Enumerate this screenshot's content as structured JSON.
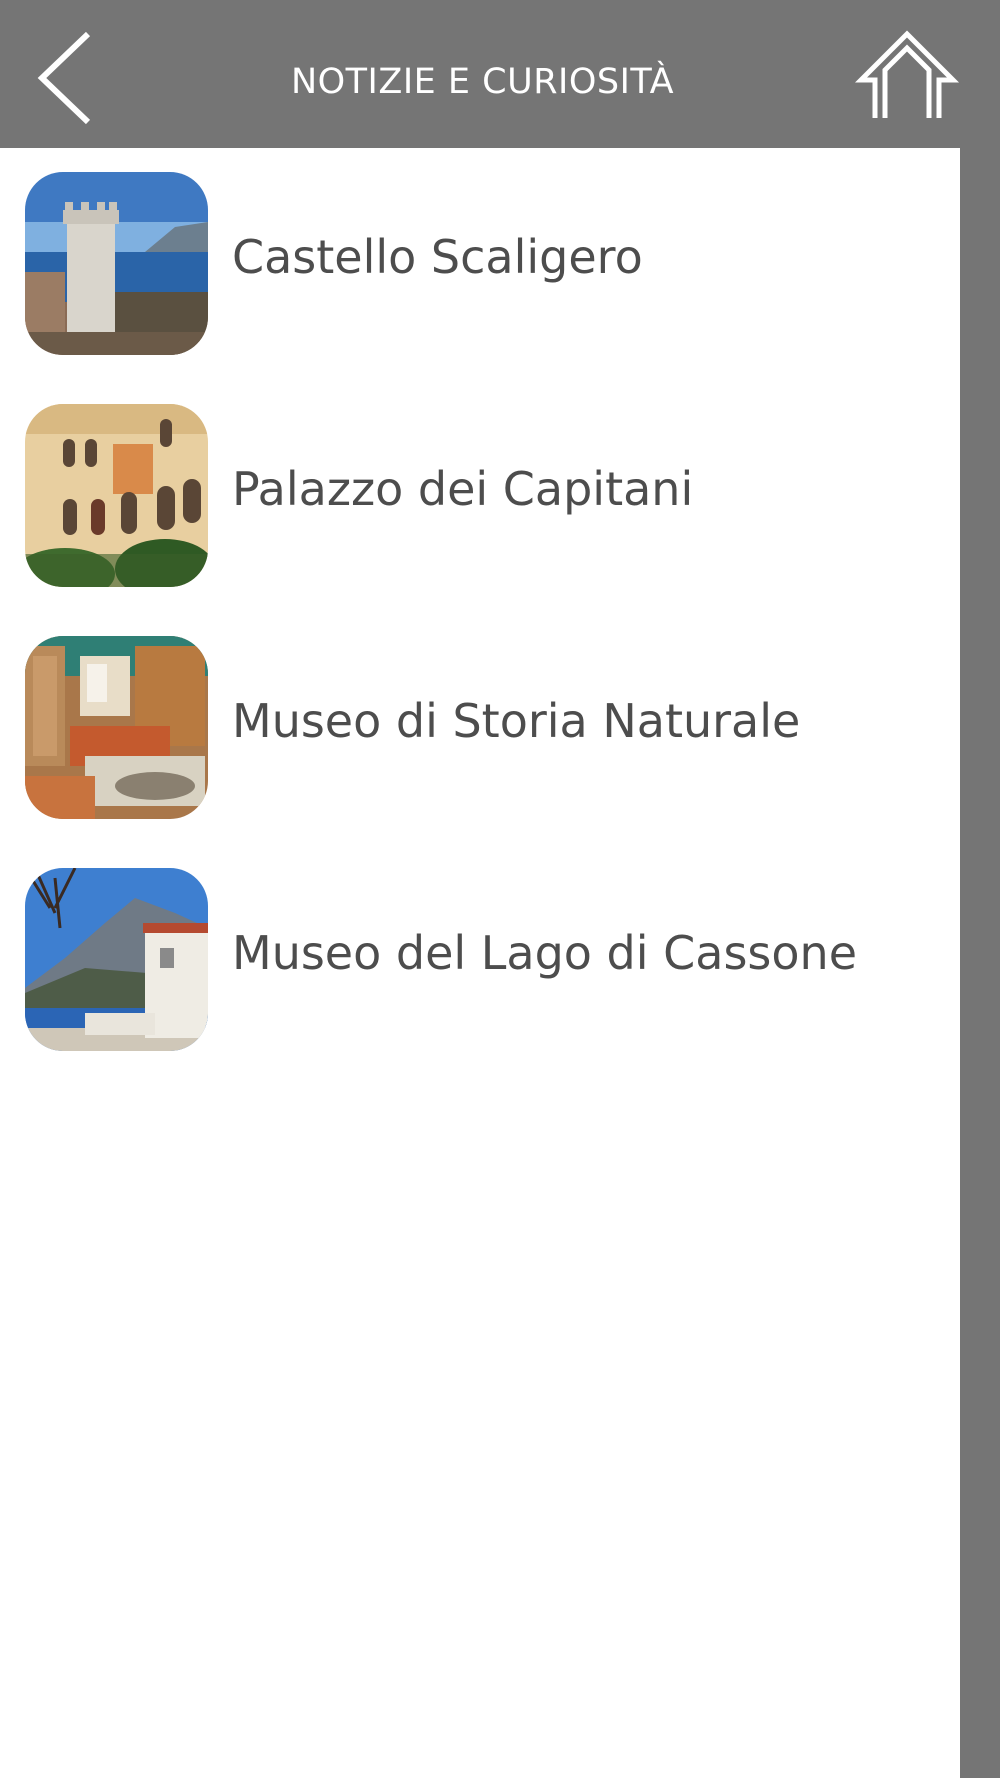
{
  "header": {
    "title": "NOTIZIE E CURIOSITÀ",
    "back_icon": "chevron-left-icon",
    "home_icon": "home-icon"
  },
  "list": {
    "items": [
      {
        "label": "Castello Scaligero",
        "thumbnail": "castle-tower-photo"
      },
      {
        "label": "Palazzo dei Capitani",
        "thumbnail": "palace-facade-photo"
      },
      {
        "label": "Museo di Storia Naturale",
        "thumbnail": "museum-interior-photo"
      },
      {
        "label": "Museo del Lago di Cassone",
        "thumbnail": "lake-museum-photo"
      }
    ]
  },
  "colors": {
    "header_bg": "#757575",
    "content_bg": "#ffffff",
    "label_text": "#4d4d4d",
    "header_text": "#ffffff"
  }
}
